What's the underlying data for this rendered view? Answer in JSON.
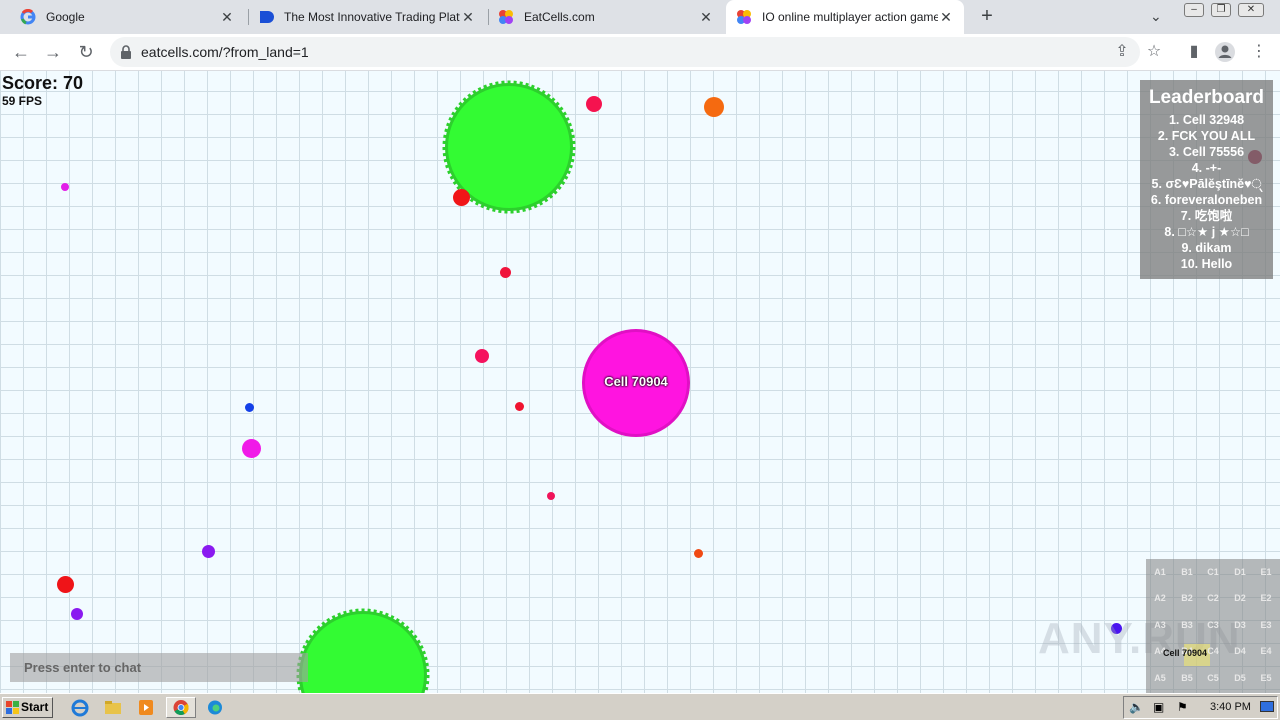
{
  "browser": {
    "tabs": [
      {
        "title": "Google",
        "favicon": "google-icon"
      },
      {
        "title": "The Most Innovative Trading Platform",
        "favicon": "trading-icon"
      },
      {
        "title": "EatCells.com",
        "favicon": "eatcells-icon"
      },
      {
        "title": "IO online multiplayer action game. Si",
        "favicon": "eatcells-icon"
      }
    ],
    "url": "eatcells.com/?from_land=1"
  },
  "game": {
    "score_text": "Score: 70",
    "fps_text": "59 FPS",
    "player": {
      "name": "Cell 70904",
      "color": "#ff14e0"
    },
    "leaderboard": {
      "title": "Leaderboard",
      "entries": [
        "1. Cell 32948",
        "2. FCK YOU ALL",
        "3. Cell 75556",
        "4. -+-",
        "5. σƐ♥Pālĕştīnĕ♥્",
        "6. foreveraloneben",
        "7. 吃饱啦",
        "8. □☆★ j ★☆□",
        "9. dikam",
        "10. Hello"
      ]
    },
    "chat_placeholder": "Press enter to chat",
    "minimap": {
      "rows": [
        [
          "A1",
          "B1",
          "C1",
          "D1",
          "E1"
        ],
        [
          "A2",
          "B2",
          "C2",
          "D2",
          "E2"
        ],
        [
          "A3",
          "B3",
          "C3",
          "D3",
          "E3"
        ],
        [
          "A4",
          "B4",
          "C4",
          "D4",
          "E4"
        ],
        [
          "A5",
          "B5",
          "C5",
          "D5",
          "E5"
        ]
      ],
      "player_label": "Cell 70904"
    },
    "watermark": "ANY.RUN",
    "colors": {
      "virus": "#33fb33",
      "virus_border": "#2dd02d",
      "background": "#f2fbff",
      "grid": "#cfdde4"
    }
  },
  "taskbar": {
    "start_label": "Start",
    "clock": "3:40 PM"
  }
}
